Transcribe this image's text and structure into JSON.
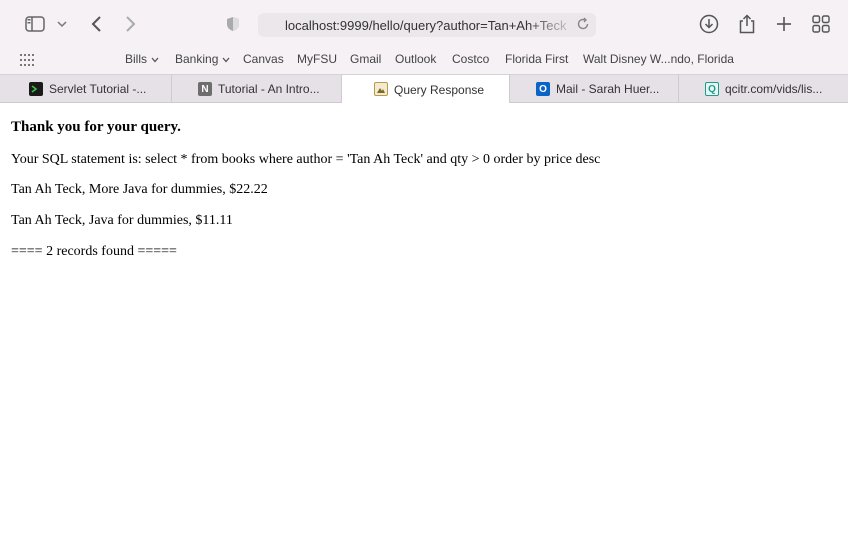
{
  "browser": {
    "url": "localhost:9999/hello/query?author=Tan+Ah+Teck",
    "icons": {
      "sidebar": "sidebar-icon",
      "back": "back-arrow-icon",
      "forward": "forward-arrow-icon",
      "shield": "privacy-shield-icon",
      "reload": "reload-icon",
      "download": "download-icon",
      "share": "share-icon",
      "new_tab": "plus-icon",
      "tab_overview": "grid-icon",
      "bookmarks_grid": "apps-grid-icon"
    }
  },
  "bookmarks": [
    {
      "label": "Bills"
    },
    {
      "label": "Banking"
    },
    {
      "label": "Canvas"
    },
    {
      "label": "MyFSU"
    },
    {
      "label": "Gmail"
    },
    {
      "label": "Outlook"
    },
    {
      "label": "Costco"
    },
    {
      "label": "Florida First"
    },
    {
      "label": "Walt Disney W...ndo, Florida"
    }
  ],
  "tabs": [
    {
      "label": "Servlet Tutorial -...",
      "favicon_color": "#1f7a1f"
    },
    {
      "label": "Tutorial - An Intro...",
      "favicon_color": "#6e6e6e",
      "favicon_letter": "N"
    },
    {
      "label": "Query Response",
      "favicon_color": "#c9a233"
    },
    {
      "label": "Mail - Sarah Huer...",
      "favicon_color": "#0a64c8",
      "favicon_letter": "O"
    },
    {
      "label": "qcitr.com/vids/lis...",
      "favicon_color": "#1e9c8c",
      "favicon_letter": "Q"
    }
  ],
  "page": {
    "heading": "Thank you for your query.",
    "sql": "Your SQL statement is: select * from books where author = 'Tan Ah Teck' and qty > 0 order by price desc",
    "records": [
      "Tan Ah Teck, More Java for dummies, $22.22",
      "Tan Ah Teck, Java for dummies, $11.11"
    ],
    "summary": "==== 2 records found ====="
  }
}
